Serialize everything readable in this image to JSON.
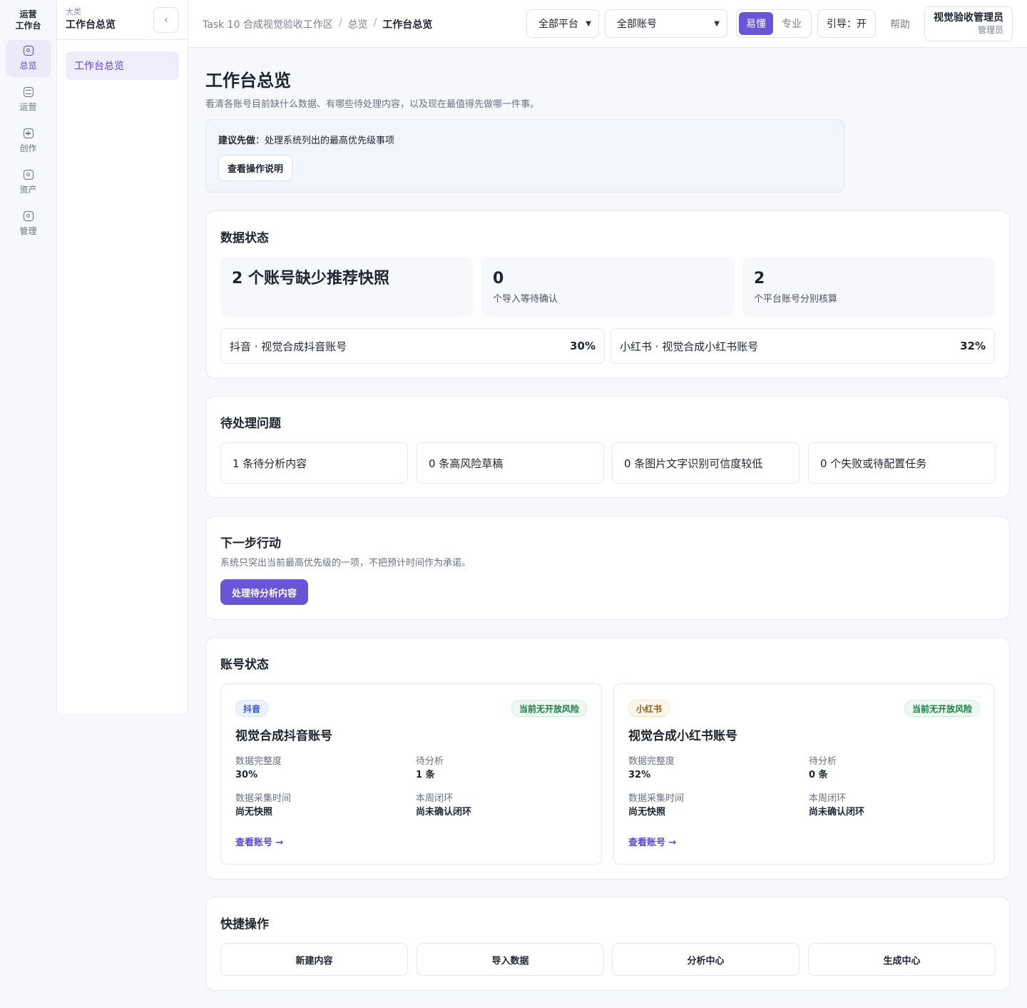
{
  "rail": {
    "brand_line1": "运营",
    "brand_line2": "工作台",
    "items": [
      {
        "label": "总览",
        "icon": "overview-icon",
        "active": true
      },
      {
        "label": "运营",
        "icon": "operations-icon"
      },
      {
        "label": "创作",
        "icon": "create-icon"
      },
      {
        "label": "资产",
        "icon": "assets-icon"
      },
      {
        "label": "管理",
        "icon": "manage-icon"
      }
    ]
  },
  "subnav": {
    "kicker": "大类",
    "title": "工作台总览",
    "collapse_glyph": "‹",
    "links": [
      {
        "label": "工作台总览",
        "active": true
      }
    ]
  },
  "topbar": {
    "breadcrumb": [
      "Task 10 合成视觉验收工作区",
      "总览",
      "工作台总览"
    ],
    "platform_select": "全部平台",
    "account_select": "全部账号",
    "mode_easy": "易懂",
    "mode_pro": "专业",
    "guide": "引导：开",
    "help": "帮助",
    "user_name": "视觉验收管理员",
    "user_role": "管理员"
  },
  "page": {
    "title": "工作台总览",
    "description": "看清各账号目前缺什么数据、有哪些待处理内容，以及现在最值得先做哪一件事。",
    "tip_label": "建议先做",
    "tip_text": "：处理系统列出的最高优先级事项",
    "tip_button": "查看操作说明"
  },
  "data_status": {
    "title": "数据状态",
    "stats": [
      {
        "value": "2 个账号缺少推荐快照",
        "sub": ""
      },
      {
        "value": "0",
        "sub": "个导入等待确认"
      },
      {
        "value": "2",
        "sub": "个平台账号分别核算"
      }
    ],
    "platforms": [
      {
        "label": "抖音 · 视觉合成抖音账号",
        "pct": "30%"
      },
      {
        "label": "小红书 · 视觉合成小红书账号",
        "pct": "32%"
      }
    ]
  },
  "pending": {
    "title": "待处理问题",
    "items": [
      "1 条待分析内容",
      "0 条高风险草稿",
      "0 条图片文字识别可信度较低",
      "0 个失败或待配置任务"
    ]
  },
  "next_action": {
    "title": "下一步行动",
    "description": "系统只突出当前最高优先级的一项，不把预计时间作为承诺。",
    "button": "处理待分析内容"
  },
  "accounts": {
    "title": "账号状态",
    "cards": [
      {
        "platform": "抖音",
        "risk": "当前无开放风险",
        "name": "视觉合成抖音账号",
        "completeness_label": "数据完整度",
        "completeness": "30%",
        "pending_label": "待分析",
        "pending": "1 条",
        "collect_label": "数据采集时间",
        "collect": "尚无快照",
        "loop_label": "本周闭环",
        "loop": "尚未确认闭环",
        "link": "查看账号 →"
      },
      {
        "platform": "小红书",
        "risk": "当前无开放风险",
        "name": "视觉合成小红书账号",
        "completeness_label": "数据完整度",
        "completeness": "32%",
        "pending_label": "待分析",
        "pending": "0 条",
        "collect_label": "数据采集时间",
        "collect": "尚无快照",
        "loop_label": "本周闭环",
        "loop": "尚未确认闭环",
        "link": "查看账号 →"
      }
    ]
  },
  "quick": {
    "title": "快捷操作",
    "items": [
      "新建内容",
      "导入数据",
      "分析中心",
      "生成中心"
    ]
  },
  "colors": {
    "accent": "#6a55d8",
    "accent_soft": "#ece9fb",
    "success": "#1e7a45",
    "tip_bg": "#f0f5fe"
  }
}
